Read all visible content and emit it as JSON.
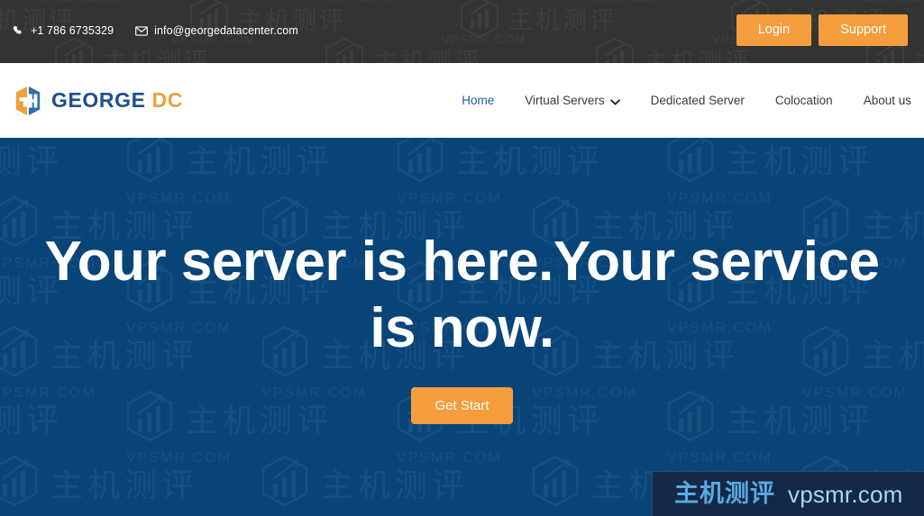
{
  "topbar": {
    "phone_icon": "phone-icon",
    "phone": "+1 786 6735329",
    "email_icon": "envelope-icon",
    "email": "info@georgedatacenter.com",
    "login_label": "Login",
    "support_label": "Support",
    "background_color": "#333333",
    "button_color": "#f59d3d"
  },
  "brand": {
    "logo_icon": "hexagon-g-logo-icon",
    "name": "GEORGE",
    "suffix": "DC",
    "name_color": "#1d4f8c",
    "suffix_color": "#f59d3d"
  },
  "nav": {
    "items": [
      {
        "label": "Home",
        "active": true,
        "has_dropdown": false
      },
      {
        "label": "Virtual Servers",
        "active": false,
        "has_dropdown": true
      },
      {
        "label": "Dedicated Server",
        "active": false,
        "has_dropdown": false
      },
      {
        "label": "Colocation",
        "active": false,
        "has_dropdown": false
      },
      {
        "label": "About us",
        "active": false,
        "has_dropdown": false
      }
    ],
    "active_color": "#1f5fa8",
    "text_color": "#3a3a3a"
  },
  "hero": {
    "title": "Your server is here.Your service is now.",
    "cta_label": "Get Start",
    "background_color": "#084477",
    "title_color": "#ffffff",
    "cta_color": "#f59d3d",
    "watermark_text_cn": "主机测评",
    "watermark_text_en": "VPSMR.COM",
    "watermark_icon": "hexagon-chart-icon"
  },
  "watermark_badge": {
    "cn": "主机测评",
    "en": "vpsmr.com",
    "background_color": "#14294a",
    "cn_color": "#5aa9e0",
    "en_color": "#a9d6f0"
  }
}
